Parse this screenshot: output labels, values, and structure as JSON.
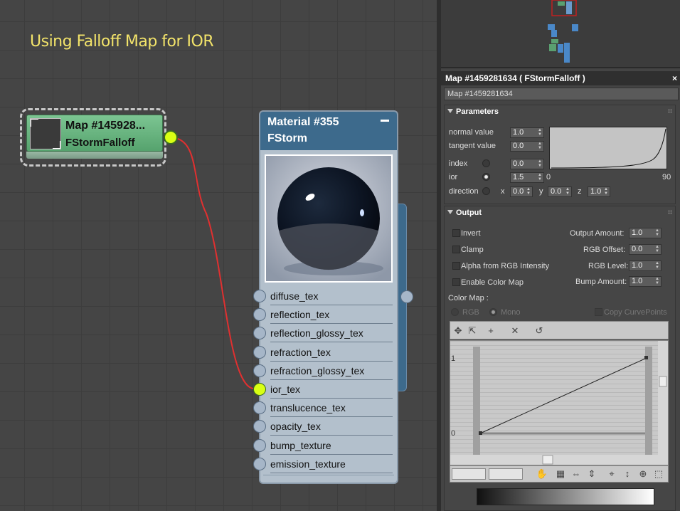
{
  "canvas": {
    "title": "Using Falloff Map for IOR",
    "map_node": {
      "title": "Map #145928...",
      "subtitle": "FStormFalloff"
    },
    "material_node": {
      "title": "Material #355",
      "subtitle": "FStorm",
      "slots": [
        "diffuse_tex",
        "reflection_tex",
        "reflection_glossy_tex",
        "refraction_tex",
        "refraction_glossy_tex",
        "ior_tex",
        "translucence_tex",
        "opacity_tex",
        "bump_texture",
        "emission_texture"
      ],
      "active_slot": "ior_tex"
    },
    "wire_color": "#e03030",
    "active_socket_color": "#d9ff14"
  },
  "panel": {
    "title": "Map #1459281634  ( FStormFalloff )",
    "close": "×",
    "map_name": "Map #1459281634",
    "parameters": {
      "header": "Parameters",
      "normal_label": "normal value",
      "normal_value": "1.0",
      "tangent_label": "tangent value",
      "tangent_value": "0.0",
      "index_label": "index",
      "index_value": "0.0",
      "ior_label": "ior",
      "ior_value": "1.5",
      "direction_label": "direction",
      "x_label": "x",
      "x_value": "0.0",
      "y_label": "y",
      "y_value": "0.0",
      "z_label": "z",
      "z_value": "1.0",
      "curve_min": "0",
      "curve_max": "90"
    },
    "output": {
      "header": "Output",
      "invert": "Invert",
      "clamp": "Clamp",
      "alpha": "Alpha from RGB Intensity",
      "enable_color_map": "Enable Color Map",
      "output_amount_label": "Output Amount:",
      "output_amount": "1.0",
      "rgb_offset_label": "RGB Offset:",
      "rgb_offset": "0.0",
      "rgb_level_label": "RGB Level:",
      "rgb_level": "1.0",
      "bump_amount_label": "Bump Amount:",
      "bump_amount": "1.0",
      "color_map_label": "Color Map :",
      "rgb": "RGB",
      "mono": "Mono",
      "copy_curve_points": "Copy CurvePoints",
      "graph_top": "1",
      "graph_bottom": "0"
    }
  }
}
